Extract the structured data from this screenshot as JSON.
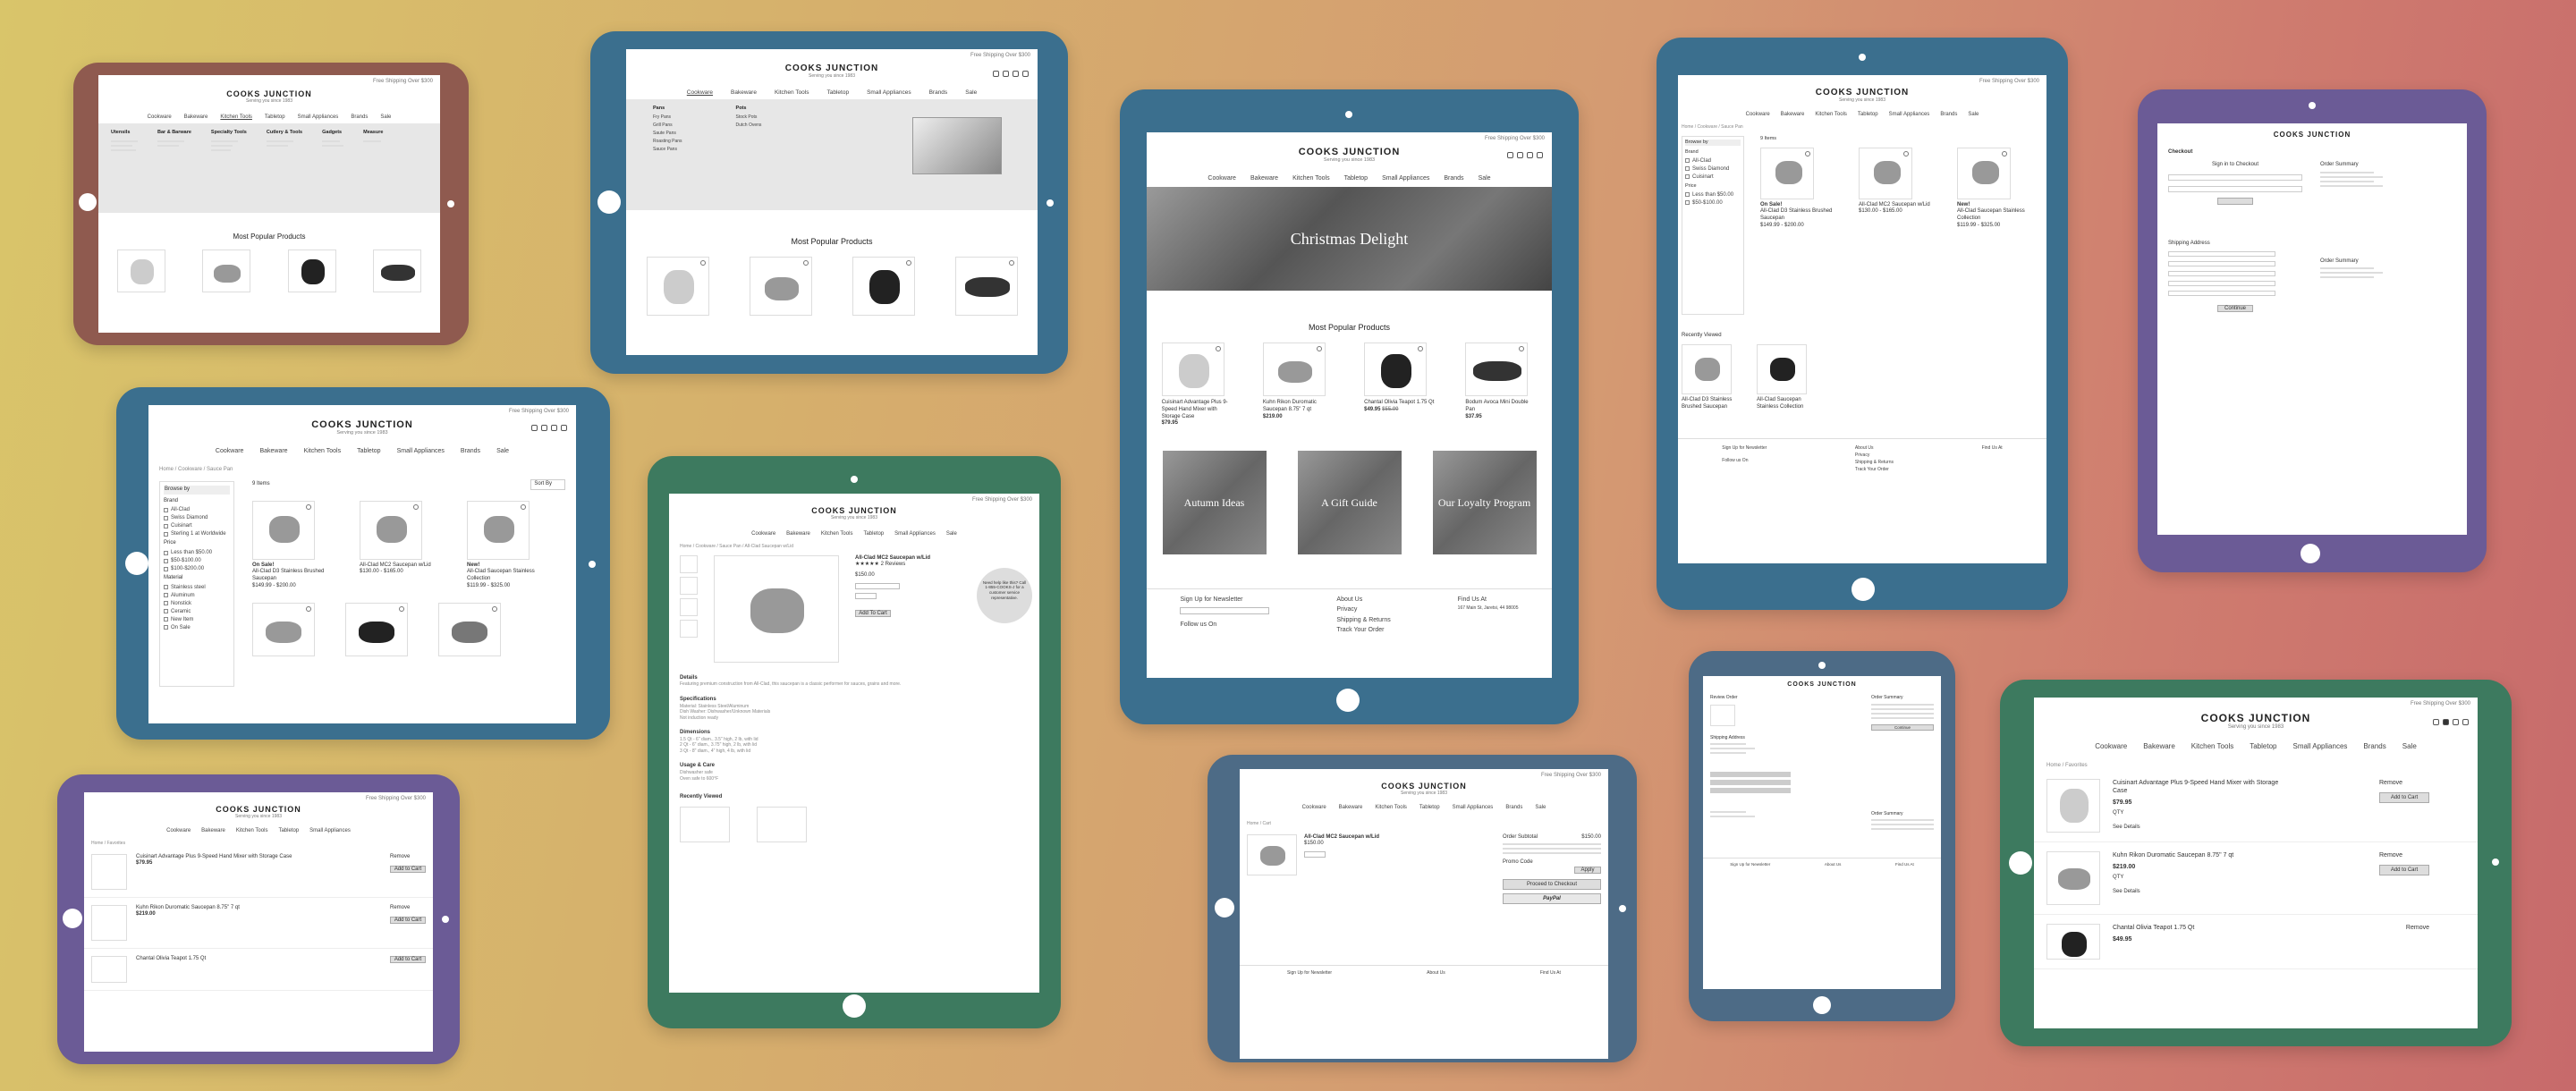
{
  "brand": {
    "logo": "COOKS JUNCTION",
    "tagline": "Serving you since 1983",
    "free_shipping": "Free Shipping Over $300"
  },
  "nav": [
    "Cookware",
    "Bakeware",
    "Kitchen Tools",
    "Tabletop",
    "Small Appliances",
    "Brands",
    "Sale"
  ],
  "hero_title": "Christmas Delight",
  "section_popular": "Most Popular Products",
  "section_recent": "Recently Viewed",
  "products": [
    {
      "name": "Cuisinart Advantage Plus 9-Speed Hand Mixer with Storage Case",
      "price": "$79.95"
    },
    {
      "name": "Kuhn Rikon Duromatic Saucepan 8.75\" 7 qt",
      "price": "$219.00"
    },
    {
      "name": "Chantal Olivia Teapot 1.75 Qt",
      "price": "$49.95",
      "old": "$55.00"
    },
    {
      "name": "Bodum Avoca Mini Double Pan",
      "price": "$37.95"
    }
  ],
  "tiles": [
    "Autumn Ideas",
    "A Gift Guide",
    "Our Loyalty Program"
  ],
  "footer": {
    "newsletter": "Sign Up for Newsletter",
    "follow": "Follow us On",
    "links": [
      "About Us",
      "Privacy",
      "Shipping & Returns",
      "Track Your Order"
    ],
    "find": "Find Us At",
    "address": [
      "167 Main St, Jaretsi, 44 98005"
    ]
  },
  "category": {
    "breadcrumb": "Home / Cookware / Sauce Pan",
    "count": "9 Items",
    "sort": "Sort By",
    "browse": "Browse by",
    "brand_head": "Brand",
    "brands": [
      "All-Clad",
      "Swiss Diamond",
      "Cuisinart",
      "Sterling 1 at Worldwide"
    ],
    "price_head": "Price",
    "prices": [
      "Less than $50.00",
      "$50-$100.00",
      "$100-$200.00"
    ],
    "material_head": "Material",
    "materials": [
      "Stainless steel",
      "Aluminum",
      "Nonstick",
      "Ceramic"
    ],
    "new_items": [
      "New Item",
      "On Sale"
    ],
    "items": [
      {
        "tag": "On Sale!",
        "name": "All-Clad D3 Stainless Brushed Saucepan",
        "price": "$149.99 - $200.00"
      },
      {
        "tag": "",
        "name": "All-Clad MC2 Saucepan w/Lid",
        "price": "$130.00 - $165.00"
      },
      {
        "tag": "New!",
        "name": "All-Clad Saucepan Stainless Collection",
        "price": "$119.99 - $325.00"
      }
    ]
  },
  "pdp": {
    "breadcrumb": "Home / Cookware / Sauce Pan / All-Clad Saucepan w/Lid",
    "title": "All-Clad MC2 Saucepan w/Lid",
    "price": "$150.00",
    "reviews": "2 Reviews",
    "add": "Add To Cart",
    "bubble": "Need help like this? Call 1-855-COOKS-J for a customer service representative.",
    "details_head": "Details",
    "details": "Featuring premium construction from All-Clad, this saucepan is a classic performer for sauces, grains and more.",
    "specs_head": "Specifications",
    "specs": [
      "Material: Stainless Steel/Aluminum",
      "Dish Washer: Dishwasher/Unknown Materials",
      "Not induction ready"
    ],
    "dims_head": "Dimensions",
    "dims": [
      "1.5 Qt - 6\" diam., 3.5\" high, 2 lb, with lid",
      "2 Qt - 6\" diam., 3.75\" high, 2 lb, with lid",
      "3 Qt - 8\" diam., 4\" high, 4 lb, with lid"
    ],
    "care_head": "Usage & Care",
    "care": [
      "Dishwasher safe",
      "Oven safe to 600°F"
    ],
    "recent": "Recently Viewed"
  },
  "cart": {
    "breadcrumb": "Home / Cart",
    "item": "All-Clad MC2 Saucepan w/Lid",
    "price": "$150.00",
    "subtotal_label": "Order Subtotal",
    "subtotal": "$150.00",
    "promo": "Promo Code",
    "apply": "Apply",
    "checkout": "Proceed to Checkout",
    "paypal": "PayPal"
  },
  "wishlist": {
    "breadcrumb": "Home / Favorites",
    "remove": "Remove",
    "add": "Add to Cart",
    "qty": "QTY",
    "details": "See Details",
    "items": [
      {
        "name": "Cuisinart Advantage Plus 9-Speed Hand Mixer with Storage Case",
        "price": "$79.95"
      },
      {
        "name": "Kuhn Rikon Duromatic Saucepan 8.75\" 7 qt",
        "price": "$219.00"
      },
      {
        "name": "Chantal Olivia Teapot 1.75 Qt",
        "price": "$49.95"
      }
    ]
  },
  "checkout": {
    "title": "Checkout",
    "signin": "Sign in to Checkout",
    "review": "Review Order",
    "summary": "Order Summary",
    "shipping": "Shipping Address",
    "continue": "Continue"
  },
  "mega": {
    "headers": [
      "Utensils",
      "Bar & Barware",
      "Specialty Tools",
      "Cutlery & Tools",
      "Gadgets",
      "Measure"
    ],
    "pans": [
      "Pans",
      "Fry Pans",
      "Grill Pans",
      "Saute Pans",
      "Roasting Pans",
      "Sauce Pans"
    ],
    "pots": [
      "Pots",
      "Stock Pots",
      "Dutch Ovens"
    ]
  },
  "colors": {
    "frame_brown": "#8f5a4f",
    "frame_blue": "#3b6f8e",
    "frame_green": "#3d7a5f",
    "frame_purple": "#6b5b96",
    "frame_slate": "#4d6b86"
  }
}
